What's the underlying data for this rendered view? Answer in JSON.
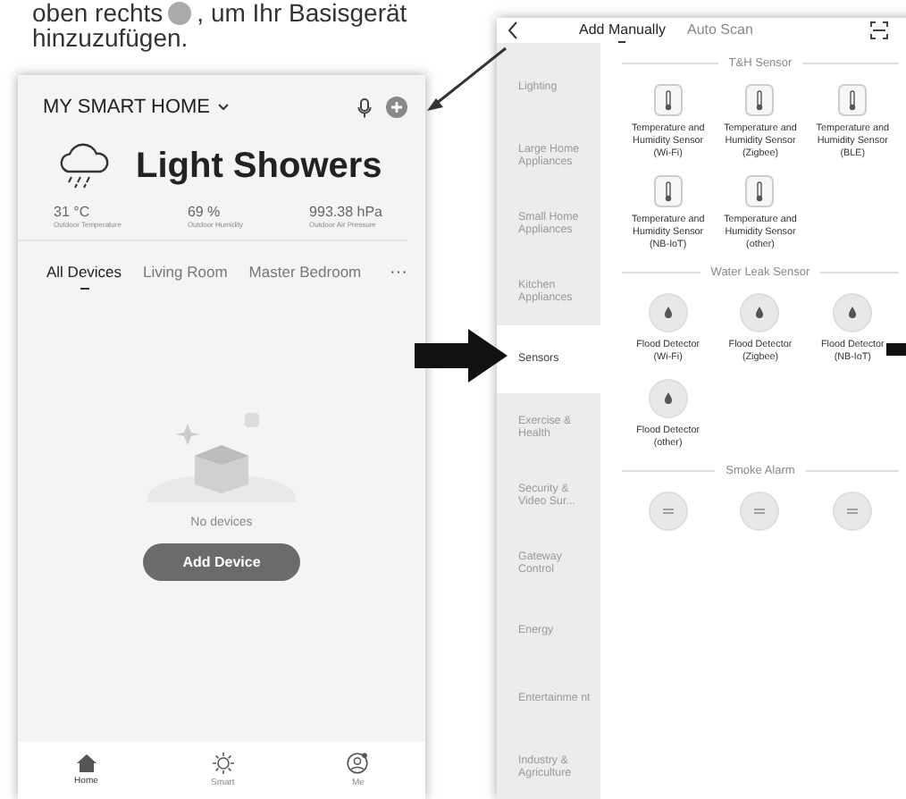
{
  "instruction": {
    "before": "oben rechts",
    "after": ", um Ihr Basisgerät",
    "line2": "hinzuzufügen."
  },
  "home_screen": {
    "home_name": "MY SMART HOME",
    "weather": {
      "condition": "Light Showers",
      "stats": [
        {
          "value": "31 °C",
          "label": "Outdoor Temperature"
        },
        {
          "value": "69 %",
          "label": "Outdoor Humidity"
        },
        {
          "value": "993.38 hPa",
          "label": "Outdoor Air Pressure"
        }
      ]
    },
    "rooms": [
      {
        "label": "All Devices",
        "selected": true
      },
      {
        "label": "Living Room",
        "selected": false
      },
      {
        "label": "Master Bedroom",
        "selected": false
      }
    ],
    "more": "···",
    "empty_text": "No devices",
    "add_button": "Add Device",
    "nav": [
      {
        "label": "Home",
        "kind": "home",
        "selected": true
      },
      {
        "label": "Smart",
        "kind": "smart",
        "selected": false
      },
      {
        "label": "Me",
        "kind": "me",
        "selected": false
      }
    ]
  },
  "add_screen": {
    "tabs": [
      {
        "label": "Add Manually",
        "selected": true
      },
      {
        "label": "Auto Scan",
        "selected": false
      }
    ],
    "categories": [
      {
        "label": "Lighting",
        "selected": false
      },
      {
        "label": "Large Home Appliances",
        "selected": false
      },
      {
        "label": "Small Home Appliances",
        "selected": false
      },
      {
        "label": "Kitchen Appliances",
        "selected": false
      },
      {
        "label": "Sensors",
        "selected": true
      },
      {
        "label": "Exercise & Health",
        "selected": false
      },
      {
        "label": "Security & Video Sur...",
        "selected": false
      },
      {
        "label": "Gateway Control",
        "selected": false
      },
      {
        "label": "Energy",
        "selected": false
      },
      {
        "label": "Entertainme nt",
        "selected": false
      },
      {
        "label": "Industry & Agriculture",
        "selected": false
      }
    ],
    "sections": [
      {
        "title": "T&H Sensor",
        "devices": [
          {
            "kind": "thermo",
            "label": "Temperature and Humidity Sensor (Wi-Fi)"
          },
          {
            "kind": "thermo",
            "label": "Temperature and Humidity Sensor (Zigbee)"
          },
          {
            "kind": "thermo",
            "label": "Temperature and Humidity Sensor (BLE)"
          },
          {
            "kind": "thermo",
            "label": "Temperature and Humidity Sensor (NB-IoT)"
          },
          {
            "kind": "thermo",
            "label": "Temperature and Humidity Sensor (other)"
          }
        ]
      },
      {
        "title": "Water Leak Sensor",
        "devices": [
          {
            "kind": "drop",
            "label": "Flood Detector (Wi-Fi)"
          },
          {
            "kind": "drop",
            "label": "Flood Detector (Zigbee)"
          },
          {
            "kind": "drop",
            "label": "Flood Detector (NB-IoT)"
          },
          {
            "kind": "drop",
            "label": "Flood Detector (other)"
          }
        ]
      },
      {
        "title": "Smoke Alarm",
        "devices": [
          {
            "kind": "smoke"
          },
          {
            "kind": "smoke"
          },
          {
            "kind": "smoke"
          }
        ]
      }
    ]
  }
}
